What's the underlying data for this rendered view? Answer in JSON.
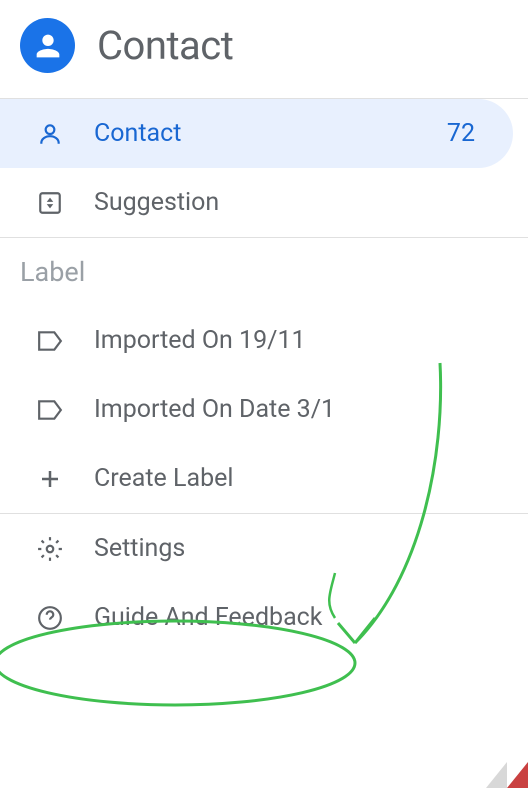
{
  "header": {
    "title": "Contact"
  },
  "nav": {
    "contact": {
      "label": "Contact",
      "count": "72"
    },
    "suggestion": {
      "label": "Suggestion"
    }
  },
  "labelSection": {
    "title": "Label",
    "items": [
      {
        "label": "Imported On 19/11"
      },
      {
        "label": "Imported On Date 3/1"
      }
    ],
    "create": "Create Label"
  },
  "footer": {
    "settings": "Settings",
    "guide": "Guide And Feedback"
  }
}
